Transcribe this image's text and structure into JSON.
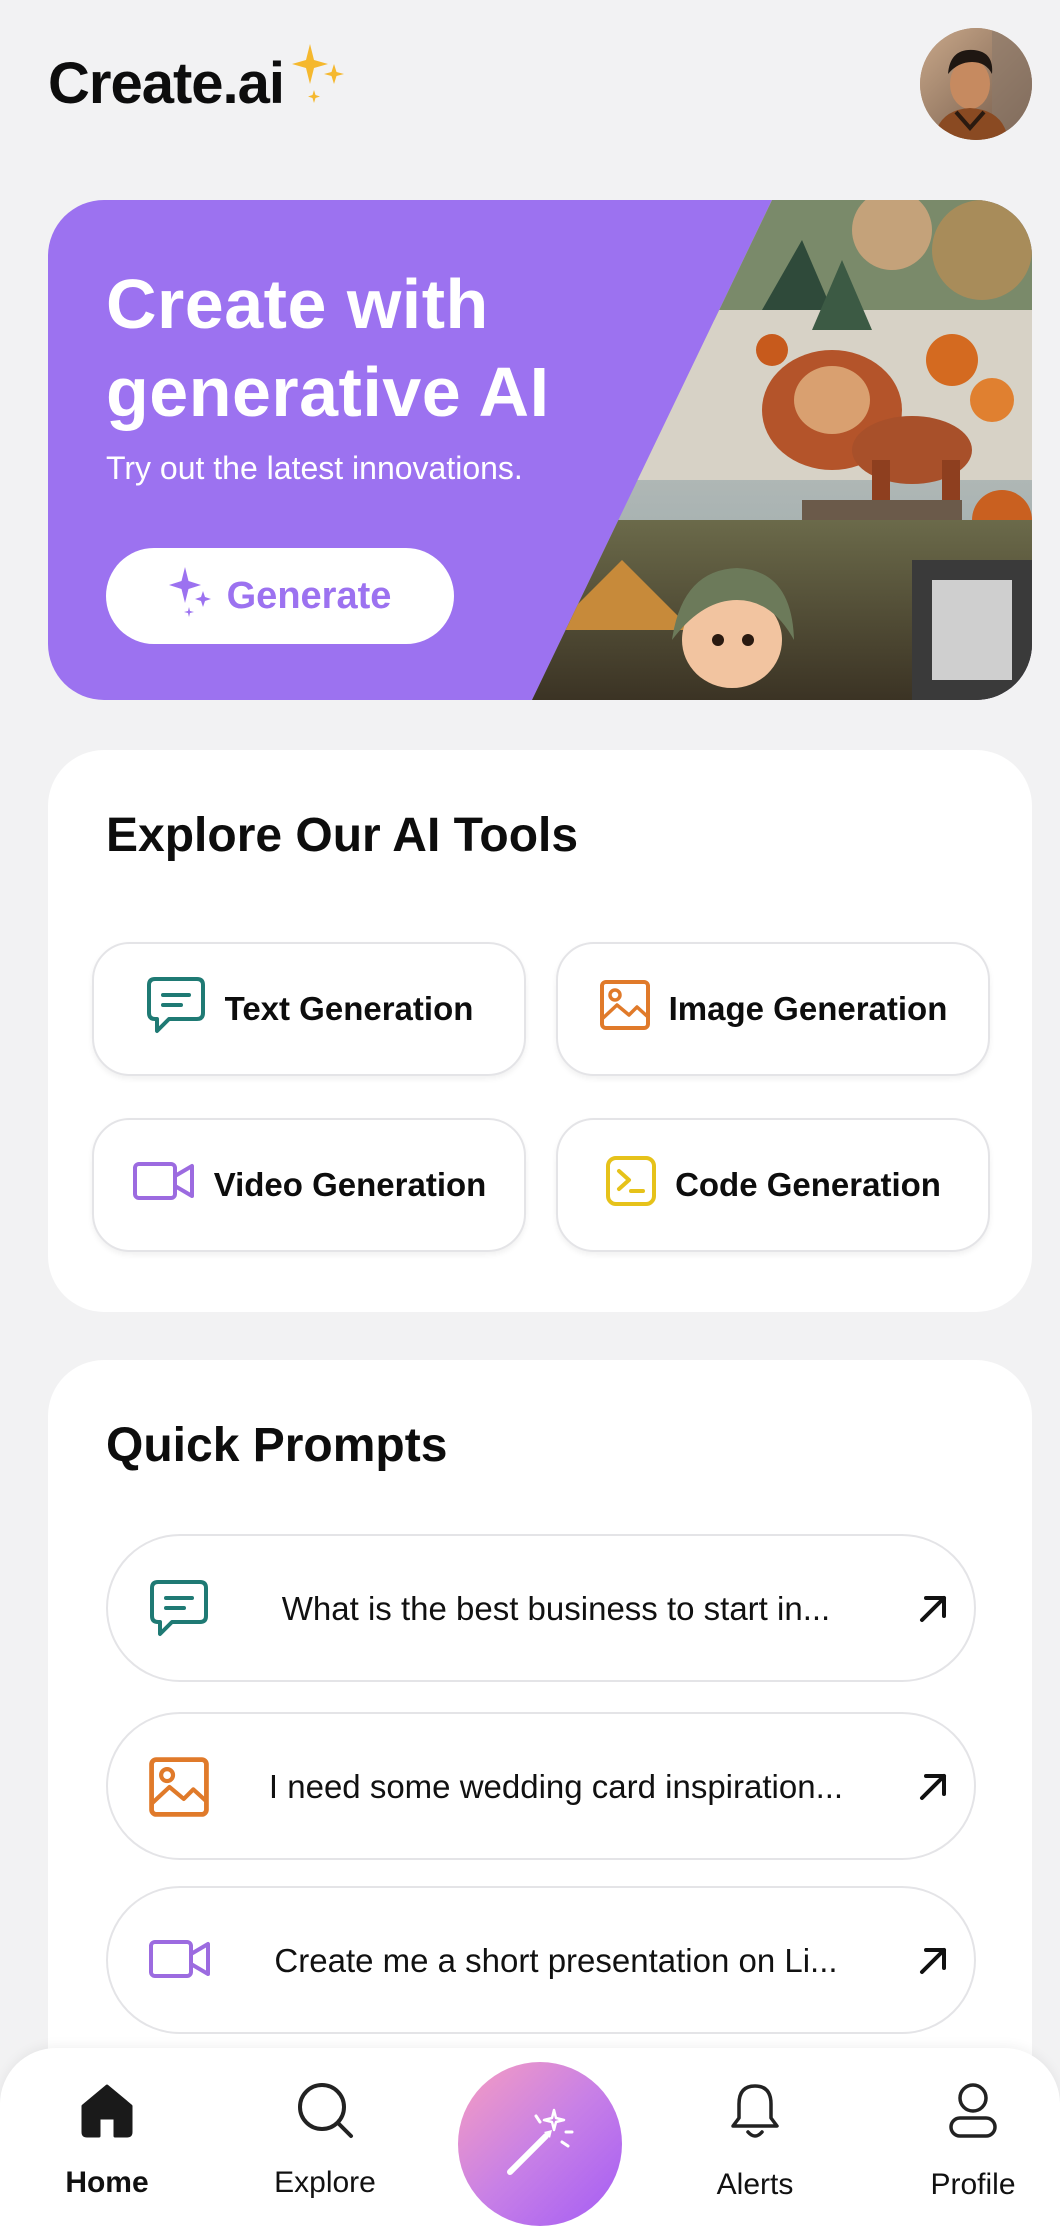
{
  "header": {
    "logo_text": "Create.ai"
  },
  "hero": {
    "title_line1": "Create with",
    "title_line2": "generative AI",
    "subtitle": "Try out the latest innovations.",
    "button_label": "Generate"
  },
  "tools": {
    "title": "Explore Our AI Tools",
    "items": [
      {
        "label": "Text Generation",
        "icon": "chat-icon",
        "color": "#1f7a74"
      },
      {
        "label": "Image Generation",
        "icon": "image-icon",
        "color": "#e07a2a"
      },
      {
        "label": "Video Generation",
        "icon": "video-icon",
        "color": "#9c6be0"
      },
      {
        "label": "Code Generation",
        "icon": "terminal-icon",
        "color": "#e6c21a"
      }
    ]
  },
  "prompts": {
    "title": "Quick Prompts",
    "items": [
      {
        "text": "What is the best business to start in...",
        "icon": "chat-icon"
      },
      {
        "text": "I need some wedding card inspiration...",
        "icon": "image-icon"
      },
      {
        "text": "Create me a short presentation on Li...",
        "icon": "video-icon"
      }
    ]
  },
  "nav": {
    "home": "Home",
    "explore": "Explore",
    "alerts": "Alerts",
    "profile": "Profile"
  },
  "colors": {
    "accent": "#9c72f0",
    "sparkle": "#f5b82e",
    "background": "#f2f2f3"
  }
}
